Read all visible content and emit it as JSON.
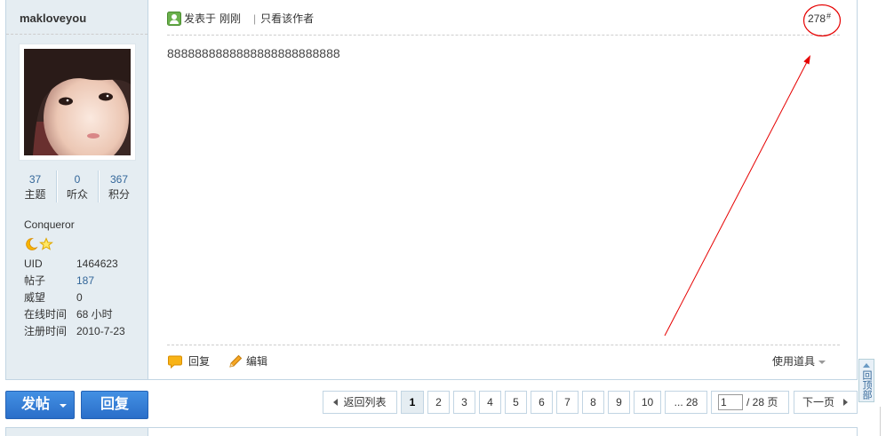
{
  "post": {
    "author": {
      "username": "makloveyou",
      "stats": [
        {
          "value": "37",
          "label": "主题"
        },
        {
          "value": "0",
          "label": "听众"
        },
        {
          "value": "367",
          "label": "积分"
        }
      ],
      "rank": "Conqueror",
      "rank_icons": [
        "moon-icon",
        "star-icon"
      ],
      "info": [
        {
          "label": "UID",
          "value": "1464623"
        },
        {
          "label": "帖子",
          "value": "187"
        },
        {
          "label": "威望",
          "value": "0"
        },
        {
          "label": "在线时间",
          "value": "68 小时"
        },
        {
          "label": "注册时间",
          "value": "2010-7-23"
        }
      ]
    },
    "meta": {
      "status_icon": "user-post-icon",
      "posted_prefix": "发表于",
      "posted_time": "刚刚",
      "separator": "|",
      "author_only": "只看该作者",
      "floor_number": "278",
      "floor_suffix": "#"
    },
    "body": "8888888888888888888888888",
    "actions": {
      "reply_icon": "speech-bubble-icon",
      "reply": "回复",
      "edit_icon": "pencil-icon",
      "edit": "编辑",
      "tools": "使用道具"
    }
  },
  "toolbar": {
    "new_thread": "发帖",
    "reply": "回复"
  },
  "pagination": {
    "back": "返回列表",
    "pages": [
      "1",
      "2",
      "3",
      "4",
      "5",
      "6",
      "7",
      "8",
      "9",
      "10"
    ],
    "current_page": 1,
    "last": "... 28",
    "jump_value": "1",
    "total": "/ 28 页",
    "next": "下一页"
  },
  "back_to_top": "回顶部",
  "colors": {
    "link_blue": "#336699",
    "sidebar_bg": "#e5edf2",
    "border": "#c2d5e3",
    "button_blue": "#2b73cf",
    "annotation_red": "#e60000"
  }
}
